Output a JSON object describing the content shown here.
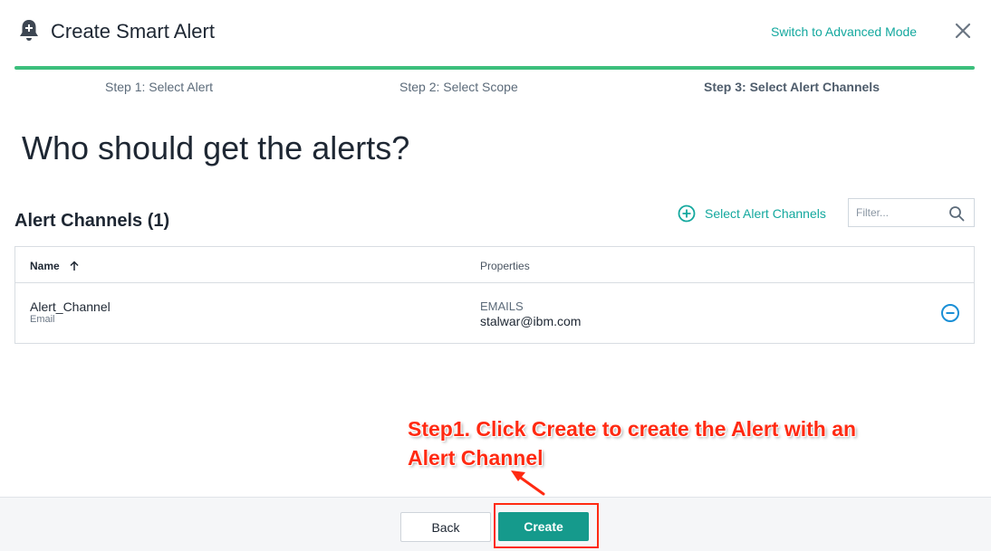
{
  "header": {
    "title": "Create Smart Alert",
    "advanced_mode_link": "Switch to Advanced Mode",
    "icons": {
      "title_icon": "bell-plus-icon",
      "close_icon": "close-icon"
    }
  },
  "wizard": {
    "progress_percent": 100,
    "steps": [
      {
        "label": "Step 1: Select Alert",
        "active": false
      },
      {
        "label": "Step 2: Select Scope",
        "active": false
      },
      {
        "label": "Step 3: Select Alert Channels",
        "active": true
      }
    ]
  },
  "main": {
    "question": "Who should get the alerts?",
    "section_title": "Alert Channels (1)",
    "select_channels_label": "Select Alert Channels",
    "filter": {
      "placeholder": "Filter...",
      "value": ""
    },
    "table": {
      "columns": [
        {
          "label": "Name",
          "sort": "ascending"
        },
        {
          "label": "Properties"
        }
      ],
      "rows": [
        {
          "name": "Alert_Channel",
          "type": "Email",
          "property_key": "EMAILS",
          "property_value": "stalwar@ibm.com"
        }
      ]
    }
  },
  "annotation": {
    "text": "Step1. Click Create to create the Alert with an Alert Channel",
    "color": "#ff2a12"
  },
  "footer": {
    "back_label": "Back",
    "create_label": "Create"
  },
  "colors": {
    "accent": "#13a89e",
    "progress": "#3cbf7c",
    "primary_button": "#159a8c",
    "remove_icon": "#1a8fd6"
  }
}
